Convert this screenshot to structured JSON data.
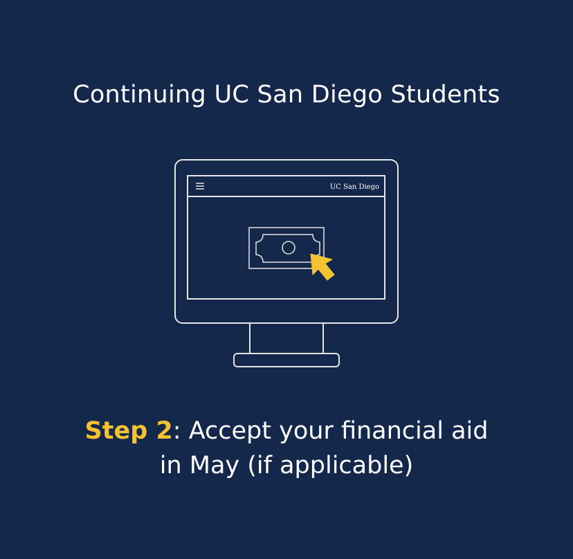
{
  "title": "Continuing UC San Diego Students",
  "illustration": {
    "logo_text": "UC San Diego",
    "icons": {
      "menu": "hamburger-menu-icon",
      "bill": "dollar-bill-icon",
      "cursor": "cursor-arrow-icon"
    }
  },
  "caption": {
    "step_label": "Step 2",
    "line1_rest": ": Accept your financial aid",
    "line2": "in May (if applicable)"
  },
  "colors": {
    "background": "#13284a",
    "accent": "#f5c232",
    "line": "#ffffff"
  }
}
